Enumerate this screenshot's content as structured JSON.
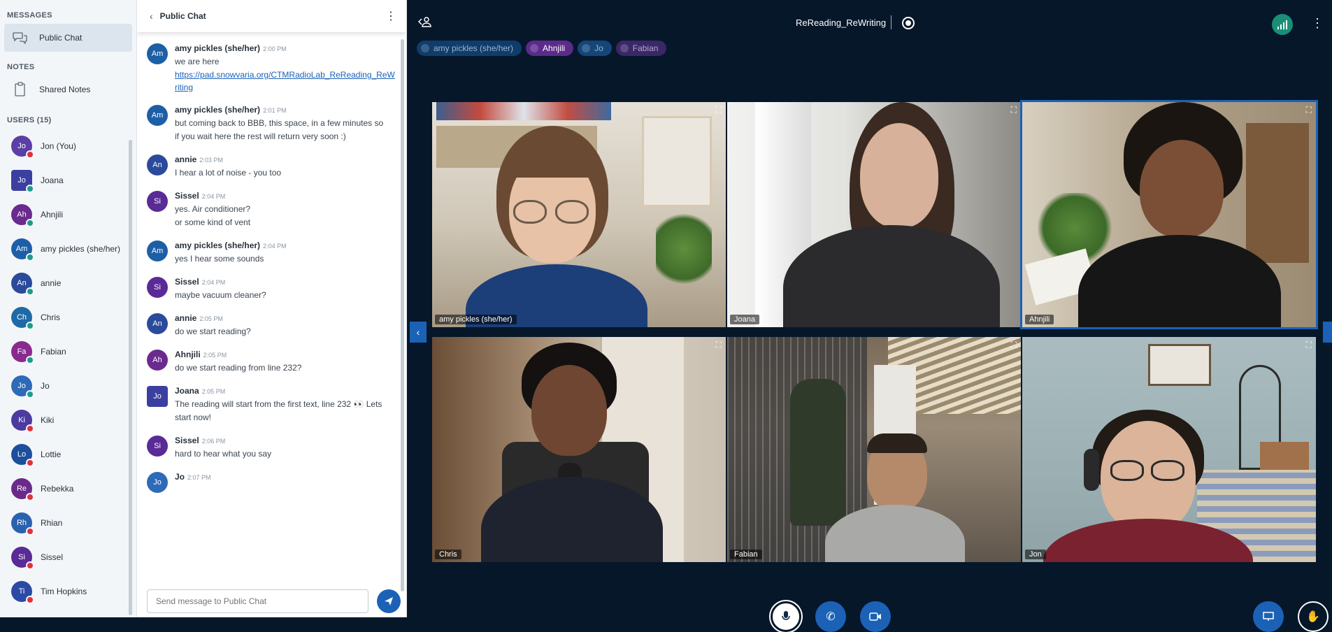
{
  "sidebar": {
    "messages_title": "MESSAGES",
    "public_chat_label": "Public Chat",
    "notes_title": "NOTES",
    "shared_notes_label": "Shared Notes",
    "users_title": "USERS (15)",
    "users": [
      {
        "initials": "Jo",
        "name": "Jon (You)",
        "color": "#5b3ea6",
        "status": "#e0323c",
        "shape": "round"
      },
      {
        "initials": "Jo",
        "name": "Joana",
        "color": "#3b3fa0",
        "status": "#1a9c8c",
        "shape": "square"
      },
      {
        "initials": "Ah",
        "name": "Ahnjili",
        "color": "#6b2a8f",
        "status": "#1a9c8c",
        "shape": "round"
      },
      {
        "initials": "Am",
        "name": "amy pickles (she/her)",
        "color": "#1d5fa6",
        "status": "#1a9c8c",
        "shape": "round"
      },
      {
        "initials": "An",
        "name": "annie",
        "color": "#2b4a9c",
        "status": "#1a9c8c",
        "shape": "round"
      },
      {
        "initials": "Ch",
        "name": "Chris",
        "color": "#1e6aa6",
        "status": "#1a9c8c",
        "shape": "round"
      },
      {
        "initials": "Fa",
        "name": "Fabian",
        "color": "#8a2a8f",
        "status": "#1a9c8c",
        "shape": "round"
      },
      {
        "initials": "Jo",
        "name": "Jo",
        "color": "#2d6ab8",
        "status": "#1a9c8c",
        "shape": "round"
      },
      {
        "initials": "Ki",
        "name": "Kiki",
        "color": "#4b3aa0",
        "status": "#e0323c",
        "shape": "round"
      },
      {
        "initials": "Lo",
        "name": "Lottie",
        "color": "#1d4f9c",
        "status": "#e0323c",
        "shape": "round"
      },
      {
        "initials": "Re",
        "name": "Rebekka",
        "color": "#6a2a8a",
        "status": "#e0323c",
        "shape": "round"
      },
      {
        "initials": "Rh",
        "name": "Rhian",
        "color": "#2b62b0",
        "status": "#e0323c",
        "shape": "round"
      },
      {
        "initials": "Si",
        "name": "Sissel",
        "color": "#5a2a96",
        "status": "#e0323c",
        "shape": "round"
      },
      {
        "initials": "Ti",
        "name": "Tim Hopkins",
        "color": "#2a4aa6",
        "status": "#e0323c",
        "shape": "round"
      }
    ]
  },
  "chat": {
    "title": "Public Chat",
    "composer_placeholder": "Send message to Public Chat",
    "messages": [
      {
        "initials": "Am",
        "color": "#1d5fa6",
        "shape": "round",
        "author": "amy pickles (she/her)",
        "time": "2:00 PM",
        "lines": [
          "we are here"
        ],
        "link": "https://pad.snowvaria.org/CTMRadioLab_ReReading_ReWriting"
      },
      {
        "initials": "Am",
        "color": "#1d5fa6",
        "shape": "round",
        "author": "amy pickles (she/her)",
        "time": "2:01 PM",
        "lines": [
          "but coming back to BBB, this space, in a few minutes so",
          "if you wait here the rest will return very soon :)"
        ]
      },
      {
        "initials": "An",
        "color": "#2b4a9c",
        "shape": "round",
        "author": "annie",
        "time": "2:03 PM",
        "lines": [
          "I hear a lot of noise - you too"
        ]
      },
      {
        "initials": "Si",
        "color": "#5a2a96",
        "shape": "round",
        "author": "Sissel",
        "time": "2:04 PM",
        "lines": [
          "yes. Air conditioner?",
          "or some kind of vent"
        ]
      },
      {
        "initials": "Am",
        "color": "#1d5fa6",
        "shape": "round",
        "author": "amy pickles (she/her)",
        "time": "2:04 PM",
        "lines": [
          "yes I hear some sounds"
        ]
      },
      {
        "initials": "Si",
        "color": "#5a2a96",
        "shape": "round",
        "author": "Sissel",
        "time": "2:04 PM",
        "lines": [
          "maybe vacuum cleaner?"
        ]
      },
      {
        "initials": "An",
        "color": "#2b4a9c",
        "shape": "round",
        "author": "annie",
        "time": "2:05 PM",
        "lines": [
          "do we start reading?"
        ]
      },
      {
        "initials": "Ah",
        "color": "#6b2a8f",
        "shape": "round",
        "author": "Ahnjili",
        "time": "2:05 PM",
        "lines": [
          "do we start reading from line 232?"
        ]
      },
      {
        "initials": "Jo",
        "color": "#3b3fa0",
        "shape": "square",
        "author": "Joana",
        "time": "2:05 PM",
        "lines": [
          "The reading will start from the first text, line 232 👀 Lets",
          "start now!"
        ]
      },
      {
        "initials": "Si",
        "color": "#5a2a96",
        "shape": "round",
        "author": "Sissel",
        "time": "2:06 PM",
        "lines": [
          "hard to hear what you say"
        ]
      },
      {
        "initials": "Jo",
        "color": "#2d6ab8",
        "shape": "round",
        "author": "Jo",
        "time": "2:07 PM",
        "lines": []
      }
    ]
  },
  "meeting": {
    "title": "ReReading_ReWriting",
    "talkers": [
      {
        "name": "amy pickles (she/her)",
        "bg": "#0f3d6b",
        "fg": "#9fb4c8"
      },
      {
        "name": "Ahnjili",
        "bg": "#5b2b8a",
        "fg": "#ffffff"
      },
      {
        "name": "Jo",
        "bg": "#14467a",
        "fg": "#9fb4c8"
      },
      {
        "name": "Fabian",
        "bg": "#3a2766",
        "fg": "#b4a8cc"
      }
    ],
    "tiles": [
      {
        "name": "amy pickles (she/her)",
        "speaking": false
      },
      {
        "name": "Joana",
        "speaking": false
      },
      {
        "name": "Ahnjili",
        "speaking": true
      },
      {
        "name": "Chris",
        "speaking": false
      },
      {
        "name": "Fabian",
        "speaking": false
      },
      {
        "name": "Jon",
        "speaking": false
      }
    ]
  },
  "icons": {
    "public_chat": "chat-bubbles-icon",
    "shared_notes": "notes-icon",
    "back": "chevron-left-icon",
    "menu": "vertical-dots-icon",
    "send": "send-icon",
    "users_toggle": "user-list-icon",
    "record": "record-icon",
    "connection": "signal-bars-icon",
    "fullscreen": "fullscreen-icon",
    "grid_prev": "chevron-left-icon",
    "grid_next": "chevron-right-icon",
    "mic": "microphone-icon",
    "phone": "phone-icon",
    "camera": "camera-icon",
    "presentation": "presentation-icon",
    "raise_hand": "hand-icon"
  }
}
